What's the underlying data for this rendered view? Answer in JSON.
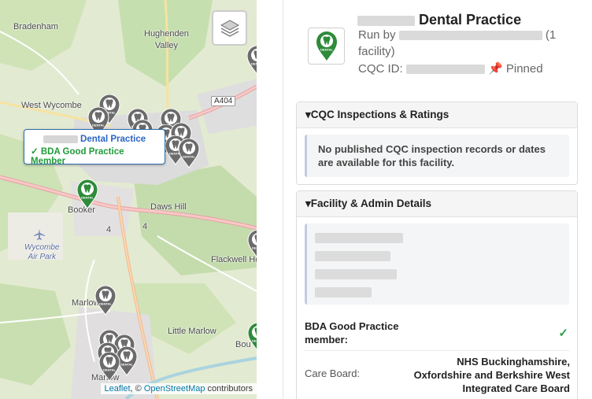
{
  "map": {
    "places": {
      "bradenham": "Bradenham",
      "hughenden_valley": "Hughenden\nValley",
      "west_wycombe": "West Wycombe",
      "daws_hill": "Daws Hill",
      "booker": "Booker",
      "wycombe_air_park": "Wycombe\nAir Park",
      "flackwell_heath": "Flackwell He",
      "marlow_b": "Marlow B",
      "little_marlow": "Little Marlow",
      "marlow": "Marlow",
      "bou": "Bou"
    },
    "road_label": "A404",
    "road_numbers": [
      "4",
      "4"
    ],
    "tooltip": {
      "title_suffix": "Dental Practice",
      "member_line": "✓ BDA Good Practice Member"
    },
    "attribution": {
      "leaflet": "Leaflet",
      "sep": ", © ",
      "osm": "OpenStreetMap",
      "contributors": " contributors"
    },
    "marker_label": "DENTAL"
  },
  "panel": {
    "title_suffix": "Dental Practice",
    "run_by_prefix": "Run by",
    "run_by_suffix": "(1",
    "facility_line": "facility)",
    "cqc_prefix": "CQC ID:",
    "pinned": "📌 Pinned",
    "sections": {
      "inspections": {
        "heading": "▾CQC Inspections & Ratings",
        "notice": "No published CQC inspection records or dates are available for this facility."
      },
      "facility": {
        "heading": "▾Facility & Admin Details",
        "bda_label": "BDA Good Practice member:",
        "bda_value": "✓",
        "care_board_label": "Care Board:",
        "care_board_value": "NHS Buckinghamshire, Oxfordshire and Berkshire West Integrated Care Board"
      }
    }
  },
  "colors": {
    "marker_green": "#2e8b3a",
    "marker_grey": "#6b6b6b",
    "link_blue": "#2a64c4",
    "success_green": "#1f9b3a"
  }
}
